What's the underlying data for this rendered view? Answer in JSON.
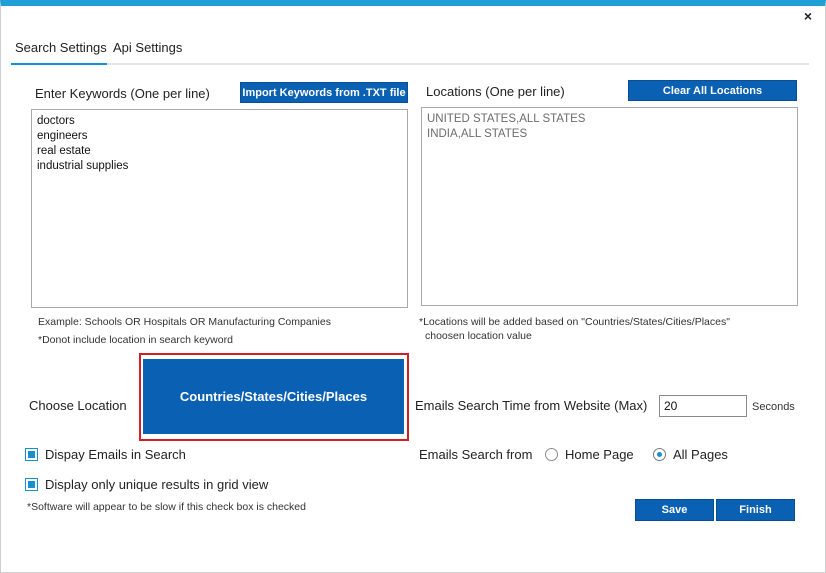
{
  "window": {
    "close_icon": "×"
  },
  "tabs": [
    {
      "label": "Search Settings",
      "active": true
    },
    {
      "label": "Api Settings",
      "active": false
    }
  ],
  "keywords": {
    "label": "Enter Keywords (One per line)",
    "import_button": "Import Keywords from .TXT file",
    "items": [
      "doctors",
      "engineers",
      "real estate",
      "industrial supplies"
    ],
    "example_text": "Example: Schools OR Hospitals OR Manufacturing Companies",
    "note_text": "*Donot include location in search keyword"
  },
  "locations": {
    "label": "Locations (One per line)",
    "clear_button": "Clear All Locations",
    "items": [
      "UNITED STATES,ALL STATES",
      "INDIA,ALL STATES"
    ],
    "note_line1": "*Locations will be added based on \"Countries/States/Cities/Places\"",
    "note_line2": "choosen location value"
  },
  "choose_location": {
    "label": "Choose Location",
    "button": "Countries/States/Cities/Places"
  },
  "email_time": {
    "label": "Emails Search Time from Website (Max)",
    "value": "20",
    "unit": "Seconds"
  },
  "options": {
    "display_emails": {
      "label": "Dispay Emails in Search",
      "checked": true
    },
    "unique_results": {
      "label": "Display only unique results in grid view",
      "checked": true
    },
    "slow_note": "*Software will appear to be slow if this check box is checked"
  },
  "email_search_from": {
    "label": "Emails Search from",
    "options": [
      {
        "label": "Home Page",
        "selected": false
      },
      {
        "label": "All Pages",
        "selected": true
      }
    ]
  },
  "actions": {
    "save": "Save",
    "finish": "Finish"
  },
  "colors": {
    "accent": "#1ea0d6",
    "button": "#0a61b3",
    "highlight_border": "#d01f25"
  }
}
